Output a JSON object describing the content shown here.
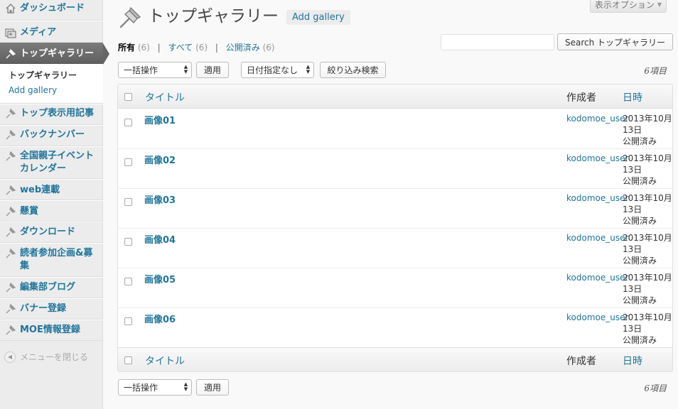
{
  "screen_options": {
    "label": "表示オプション"
  },
  "sidebar": {
    "top_items": [
      {
        "label": "ダッシュボード",
        "icon": "dashboard-icon"
      },
      {
        "label": "メディア",
        "icon": "media-icon"
      }
    ],
    "current_item": {
      "label": "トップギャラリー",
      "icon": "pin-icon"
    },
    "submenu": [
      {
        "label": "トップギャラリー"
      },
      {
        "label": "Add gallery"
      }
    ],
    "items": [
      {
        "label": "トップ表示用記事",
        "icon": "pin-icon"
      },
      {
        "label": "バックナンバー",
        "icon": "pin-icon"
      },
      {
        "label": "全国親子イベントカレンダー",
        "icon": "pin-icon"
      },
      {
        "label": "web連載",
        "icon": "pin-icon"
      },
      {
        "label": "懸賞",
        "icon": "pin-icon"
      },
      {
        "label": "ダウンロード",
        "icon": "pin-icon"
      },
      {
        "label": "読者参加企画&募集",
        "icon": "pin-icon"
      },
      {
        "label": "編集部ブログ",
        "icon": "pin-icon"
      },
      {
        "label": "バナー登録",
        "icon": "pin-icon"
      },
      {
        "label": "MOE情報登録",
        "icon": "pin-icon"
      }
    ],
    "collapse_label": "メニューを閉じる"
  },
  "header": {
    "title": "トップギャラリー",
    "add_button": "Add gallery"
  },
  "filters": {
    "all": {
      "label": "所有",
      "count": "(6)"
    },
    "everything": {
      "label": "すべて",
      "count": "(6)"
    },
    "published": {
      "label": "公開済み",
      "count": "(6)"
    },
    "separator": "|"
  },
  "search": {
    "value": "",
    "button": "Search トップギャラリー"
  },
  "bulk": {
    "selected": "一括操作",
    "apply": "適用"
  },
  "date_filter": {
    "selected": "日付指定なし",
    "button": "絞り込み検索"
  },
  "item_count": "6項目",
  "table": {
    "columns": {
      "title": "タイトル",
      "author": "作成者",
      "date": "日時"
    },
    "rows": [
      {
        "title": "画像01",
        "author": "kodomoe_user",
        "date": "2013年10月13日",
        "status": "公開済み"
      },
      {
        "title": "画像02",
        "author": "kodomoe_user",
        "date": "2013年10月13日",
        "status": "公開済み"
      },
      {
        "title": "画像03",
        "author": "kodomoe_user",
        "date": "2013年10月13日",
        "status": "公開済み"
      },
      {
        "title": "画像04",
        "author": "kodomoe_user",
        "date": "2013年10月13日",
        "status": "公開済み"
      },
      {
        "title": "画像05",
        "author": "kodomoe_user",
        "date": "2013年10月13日",
        "status": "公開済み"
      },
      {
        "title": "画像06",
        "author": "kodomoe_user",
        "date": "2013年10月13日",
        "status": "公開済み"
      }
    ]
  }
}
